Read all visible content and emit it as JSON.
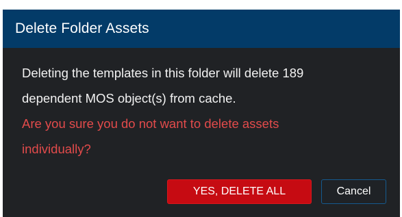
{
  "dialog": {
    "title": "Delete Folder Assets",
    "message_line1": "Deleting the templates in this folder will delete 189",
    "message_line2": "dependent MOS object(s) from cache.",
    "warning_line1": "Are you sure you do not want to delete assets",
    "warning_line2": "individually?",
    "confirm_label": "YES, DELETE ALL",
    "cancel_label": "Cancel"
  },
  "colors": {
    "titlebar": "#033b68",
    "background": "#202225",
    "warning_text": "#e24b4b",
    "danger_button": "#c60b12",
    "cancel_border": "#155a8f"
  }
}
